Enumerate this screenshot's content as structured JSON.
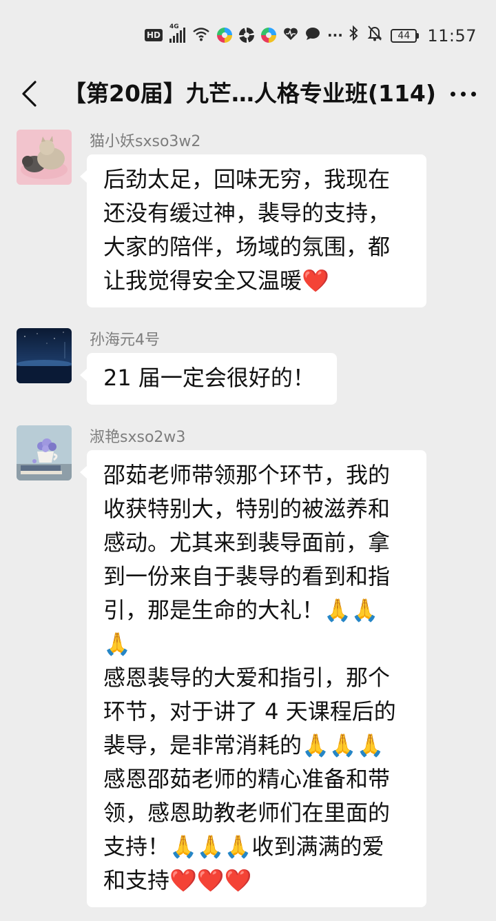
{
  "status_bar": {
    "hd": "HD",
    "network": "4G",
    "more_dots": "···",
    "battery_level": "44",
    "time": "11:57"
  },
  "header": {
    "title": "【第20届】九芒…人格专业班(114)",
    "back_icon": "back-arrow-icon",
    "more_icon": "more-dots-icon"
  },
  "messages": [
    {
      "sender": "猫小妖sxso3w2",
      "avatar": "cat-avatar",
      "lines": [
        "后劲太足，回味无穷，我现在",
        "还没有缓过神，裴导的支持，",
        "大家的陪伴，场域的氛围，都",
        "让我觉得安全又温暖❤️"
      ]
    },
    {
      "sender": "孙海元4号",
      "avatar": "night-sea-avatar",
      "lines": [
        "21 届一定会很好的！"
      ]
    },
    {
      "sender": "淑艳sxso2w3",
      "avatar": "flower-cup-avatar",
      "lines": [
        "邵茹老师带领那个环节，我的",
        "收获特别大，特别的被滋养和",
        "感动。尤其来到裴导面前，拿",
        "到一份来自于裴导的看到和指",
        "引，那是生命的大礼！🙏🙏",
        "🙏",
        "感恩裴导的大爱和指引，那个",
        "环节，对于讲了 4 天课程后的",
        "裴导，是非常消耗的🙏🙏🙏",
        "感恩邵茹老师的精心准备和带",
        "领，感恩助教老师们在里面的",
        "支持！🙏🙏🙏收到满满的爱",
        "和支持❤️❤️❤️"
      ]
    }
  ],
  "colors": {
    "background": "#ededed",
    "bubble": "#ffffff",
    "sender_text": "#7d7d7d",
    "body_text": "#111111"
  }
}
